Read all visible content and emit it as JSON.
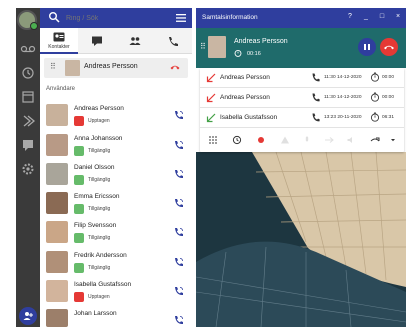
{
  "contacts_panel": {
    "search_placeholder": "Ring / Sök",
    "tabs": [
      {
        "name": "contacts",
        "label": "Kontakter",
        "icon": "contacts-card-icon",
        "active": true
      },
      {
        "name": "chat",
        "label": "",
        "icon": "chat-icon",
        "active": false
      },
      {
        "name": "groups",
        "label": "",
        "icon": "group-icon",
        "active": false
      },
      {
        "name": "phone",
        "label": "",
        "icon": "phone-icon",
        "active": false
      }
    ],
    "selected_contact": {
      "name": "Andreas Persson"
    },
    "users_header": "Användare",
    "users": [
      {
        "name": "Andreas Persson",
        "status": "Upptagen",
        "state": "busy"
      },
      {
        "name": "Anna Johansson",
        "status": "Tillgänglig",
        "state": "available"
      },
      {
        "name": "Daniel  Olsson",
        "status": "Tillgänglig",
        "state": "available"
      },
      {
        "name": "Emma Ericsson",
        "status": "Tillgänglig",
        "state": "available"
      },
      {
        "name": "Filip Svensson",
        "status": "Tillgänglig",
        "state": "available"
      },
      {
        "name": "Fredrik Andersson",
        "status": "Tillgänglig",
        "state": "available"
      },
      {
        "name": "Isabella Gustafsson",
        "status": "Upptagen",
        "state": "busy"
      },
      {
        "name": "Johan Larsson",
        "status": "",
        "state": "available"
      }
    ]
  },
  "call_panel": {
    "title": "Samtalsinformation",
    "header_controls": [
      "?",
      "_",
      "□",
      "×"
    ],
    "active_call": {
      "name": "Andreas Persson",
      "duration": "00:16"
    },
    "history": [
      {
        "name": "Andreas Persson",
        "date": "11:30 14-12-2020",
        "duration": "00:00",
        "direction": "missed"
      },
      {
        "name": "Andreas Persson",
        "date": "11:30 14-12-2020",
        "duration": "00:00",
        "direction": "missed"
      },
      {
        "name": "Isabella Gustafsson",
        "date": "13:23 20-11-2020",
        "duration": "06:31",
        "direction": "incoming"
      }
    ]
  },
  "colors": {
    "header_blue": "#2f3e9e",
    "rail_dark": "#3a3a3a",
    "active_call_teal": "#1f6b6b",
    "busy_red": "#e53935",
    "available_green": "#66bb6a",
    "missed_red": "#e53935",
    "incoming_green": "#43a047"
  }
}
